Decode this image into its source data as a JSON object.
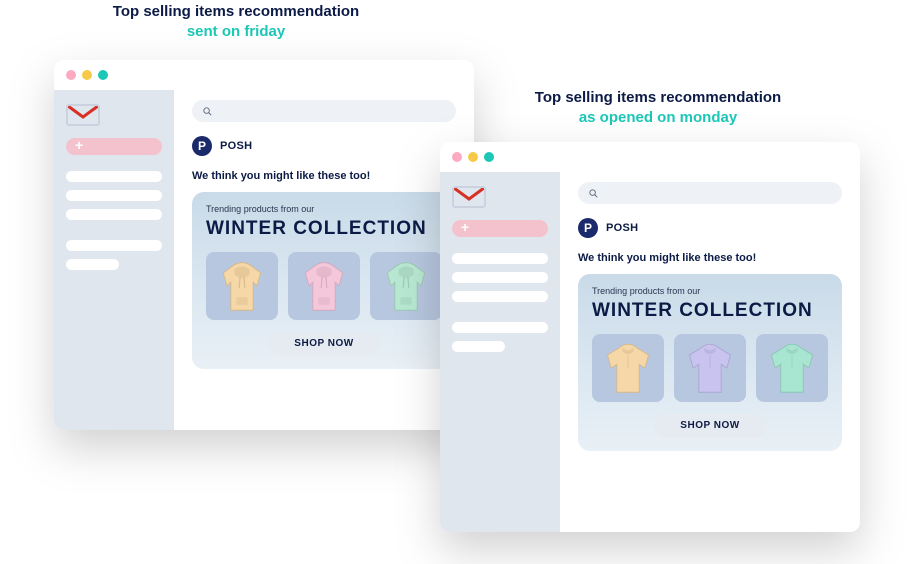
{
  "annotations": {
    "left": {
      "line1": "Top selling items recommendation",
      "line2": "sent on friday"
    },
    "right": {
      "line1": "Top selling items recommendation",
      "line2": "as opened on monday"
    }
  },
  "windows": {
    "left": {
      "sender": {
        "badge": "P",
        "name": "POSH"
      },
      "subject": "We think you might like these too!",
      "banner": {
        "subtitle": "Trending products from our",
        "title": "WINTER COLLECTION",
        "cta": "SHOP NOW",
        "products": [
          {
            "kind": "hoodie",
            "color": "#f5d7a8"
          },
          {
            "kind": "hoodie",
            "color": "#f4c7da"
          },
          {
            "kind": "hoodie",
            "color": "#b9e8d2"
          }
        ]
      }
    },
    "right": {
      "sender": {
        "badge": "P",
        "name": "POSH"
      },
      "subject": "We think you might like these too!",
      "banner": {
        "subtitle": "Trending products from our",
        "title": "WINTER COLLECTION",
        "cta": "SHOP NOW",
        "products": [
          {
            "kind": "pullover",
            "color": "#f5d7a8"
          },
          {
            "kind": "pullover",
            "color": "#c9c4ef"
          },
          {
            "kind": "pullover",
            "color": "#a8e6d2"
          }
        ]
      }
    }
  }
}
